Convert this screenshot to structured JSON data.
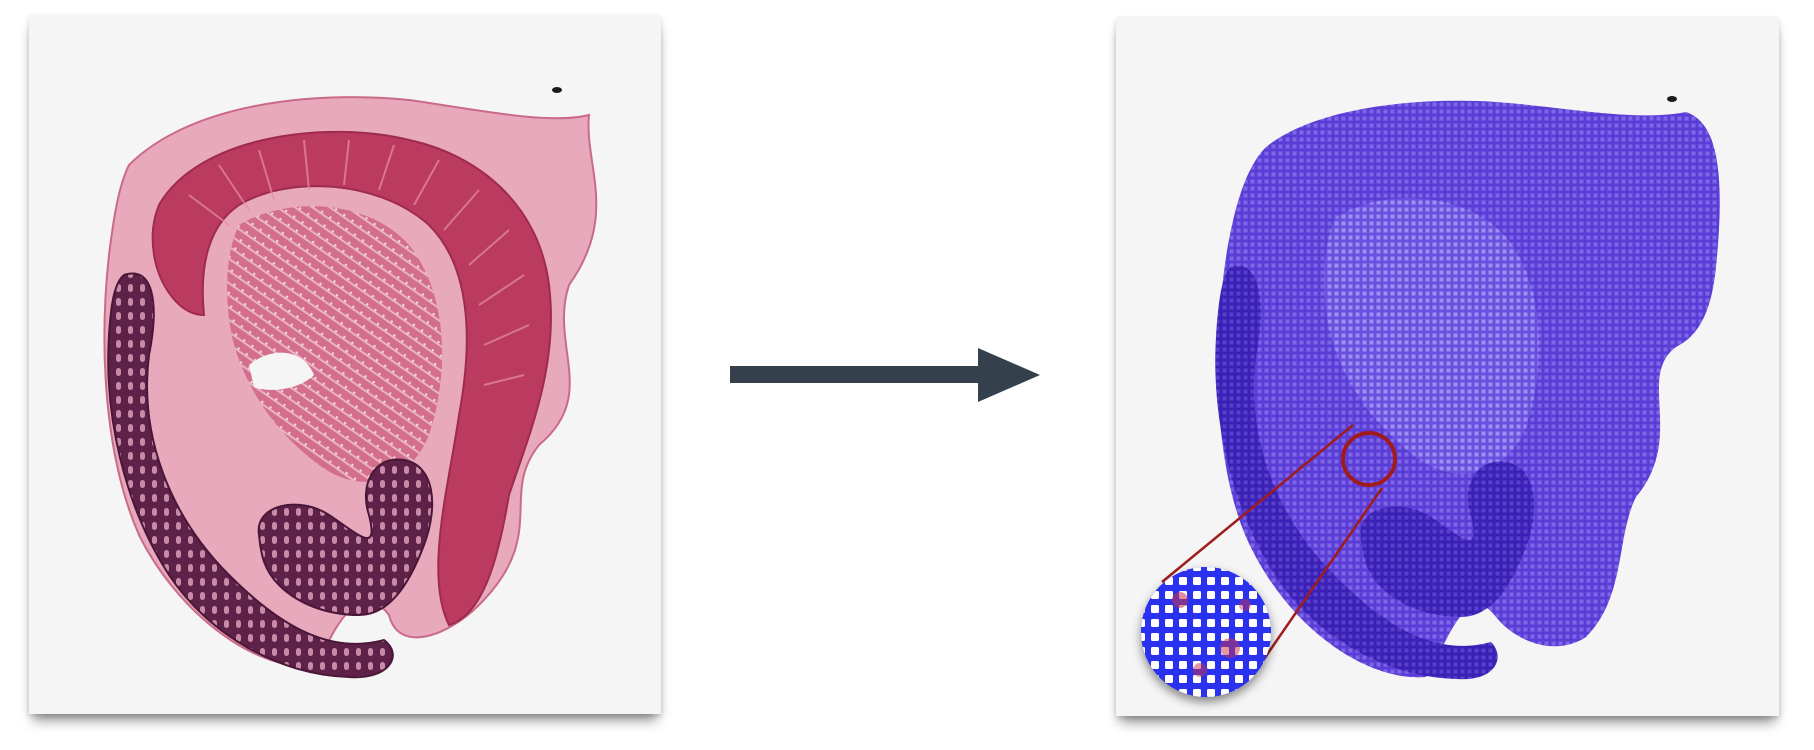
{
  "figure": {
    "input_panel": {
      "icon": "he-stained-tissue-section-image",
      "stain": "H&E",
      "colors": {
        "stroma": "#cf5c7c",
        "muscle": "#b8385c",
        "mucosa": "#6b2a54",
        "background": "#f6f5f5"
      }
    },
    "arrow": {
      "icon": "right-arrow-icon",
      "color": "#35404d"
    },
    "output_panel": {
      "icon": "spot-grid-tissue-image",
      "colors": {
        "spots": "#5538d4",
        "dense": "#3a1fb0",
        "highlight": "#a01c1c"
      }
    },
    "zoom_inset": {
      "icon": "magnified-spot-grid-icon",
      "grid_color": "#2a32f0",
      "cell_color": "#ffffff",
      "ring_color": "#a01c1c"
    }
  }
}
